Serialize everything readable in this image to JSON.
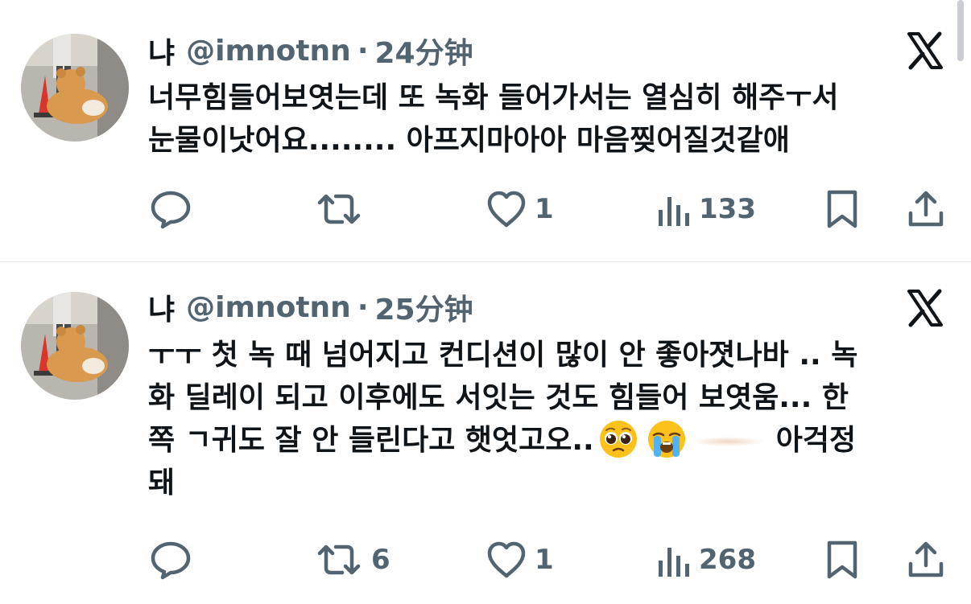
{
  "tweets": [
    {
      "name": "냐",
      "handle": "@imnotnn",
      "separator": "·",
      "time": "24分钟",
      "lines": [
        "너무힘들어보엿는데 또 녹화 들어가서는 열심히 해주ㅜ서",
        "눈물이낫어요........ 아프지마아아 마음찢어질것같애"
      ],
      "actions": {
        "reply_count": "",
        "repost_count": "",
        "like_count": "1",
        "view_count": "133"
      }
    },
    {
      "name": "냐",
      "handle": "@imnotnn",
      "separator": "·",
      "time": "25分钟",
      "lines": [
        "ㅜㅜ 첫 녹 때 넘어지고 컨디션이 많이 안 좋아졋나바 .. 녹",
        "화 딜레이 되고 이후에도 서잇는 것도 힘들어 보엿움... 한"
      ],
      "line3_text": "쪽 ㄱ귀도 잘 안 들린다고 햇엇고오..",
      "line3_tail": "아걱정",
      "line4": "돼",
      "emojis": [
        "pleading-face",
        "loudly-crying-face"
      ],
      "actions": {
        "reply_count": "",
        "repost_count": "6",
        "like_count": "1",
        "view_count": "268"
      }
    }
  ],
  "icons": {
    "reply": "speech-bubble-icon",
    "repost": "repost-arrows-icon",
    "like": "heart-icon",
    "views": "bar-chart-icon",
    "bookmark": "bookmark-icon",
    "share": "share-upload-icon",
    "logo": "x-logo-icon"
  },
  "colors": {
    "text": "#0f1419",
    "secondary": "#536471",
    "divider": "#e3e6ea",
    "background": "#ffffff"
  }
}
